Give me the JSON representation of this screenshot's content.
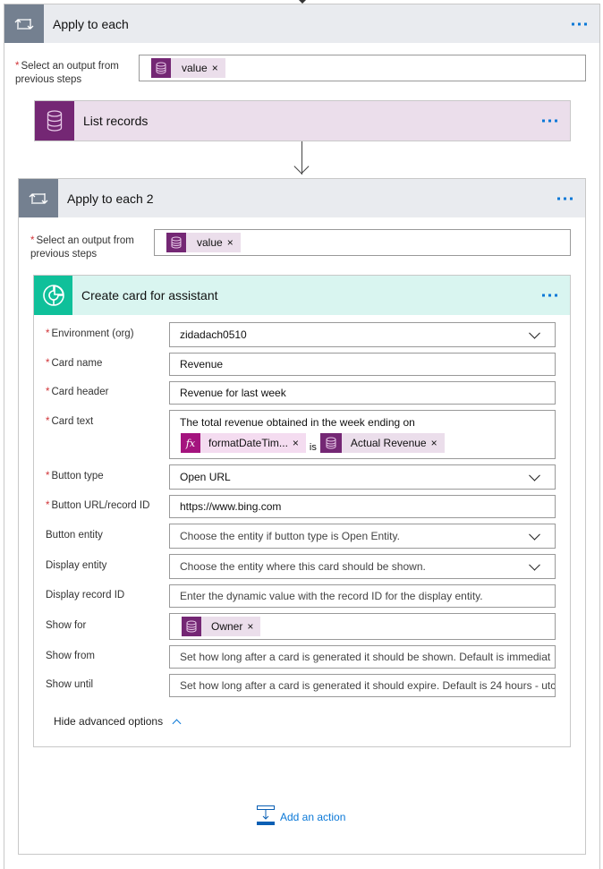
{
  "outer_loop": {
    "title": "Apply to each",
    "select_label": "Select an output from previous steps",
    "select_label_line1": "Select an output from",
    "select_label_line2": "previous steps",
    "token": {
      "label": "value",
      "icon": "database-icon"
    }
  },
  "list_records": {
    "title": "List records",
    "icon": "database-icon"
  },
  "inner_loop": {
    "title": "Apply to each 2",
    "select_label_line1": "Select an output from",
    "select_label_line2": "previous steps",
    "token": {
      "label": "value",
      "icon": "database-icon"
    }
  },
  "card_action": {
    "title": "Create card for assistant",
    "icon": "assistant-card-icon",
    "fields": {
      "environment": {
        "label": "Environment (org)",
        "required": true,
        "value": "zidadach0510",
        "type": "dropdown"
      },
      "card_name": {
        "label": "Card name",
        "required": true,
        "value": "Revenue"
      },
      "card_header": {
        "label": "Card header",
        "required": true,
        "value": "Revenue for last week"
      },
      "card_text": {
        "label": "Card text",
        "required": true,
        "text": "The total revenue obtained in the week ending on",
        "token1": {
          "label": "formatDateTim...",
          "icon": "fx-icon"
        },
        "connector": "is",
        "token2": {
          "label": "Actual Revenue",
          "icon": "database-icon"
        }
      },
      "button_type": {
        "label": "Button type",
        "required": true,
        "value": "Open URL",
        "type": "dropdown"
      },
      "button_url": {
        "label": "Button URL/record ID",
        "required": true,
        "value": "https://www.bing.com"
      },
      "button_entity": {
        "label": "Button entity",
        "placeholder": "Choose the entity if button type is Open Entity.",
        "type": "dropdown"
      },
      "display_entity": {
        "label": "Display entity",
        "placeholder": "Choose the entity where this card should be shown.",
        "type": "dropdown"
      },
      "display_record_id": {
        "label": "Display record ID",
        "placeholder": "Enter the dynamic value with the record ID for the display entity."
      },
      "show_for": {
        "label": "Show for",
        "token": {
          "label": "Owner",
          "icon": "database-icon"
        }
      },
      "show_from": {
        "label": "Show from",
        "placeholder": "Set how long after a card is generated it should be shown. Default is immediat"
      },
      "show_until": {
        "label": "Show until",
        "placeholder": "Set how long after a card is generated it should expire. Default is 24 hours - utc"
      }
    },
    "hide_advanced_label": "Hide advanced options"
  },
  "add_action_label": "Add an action",
  "required_marker": "*",
  "remove_glyph": "×",
  "colors": {
    "loop_header_bg": "#e9ebef",
    "loop_icon_bg": "#748090",
    "cds_purple": "#742774",
    "token_bg": "#ebdeeb",
    "fx_magenta": "#a4147e",
    "card_icon_teal": "#0fc09a",
    "card_header_bg": "#d9f5f0",
    "link_blue": "#0a78d7",
    "required_red": "#d13438"
  }
}
